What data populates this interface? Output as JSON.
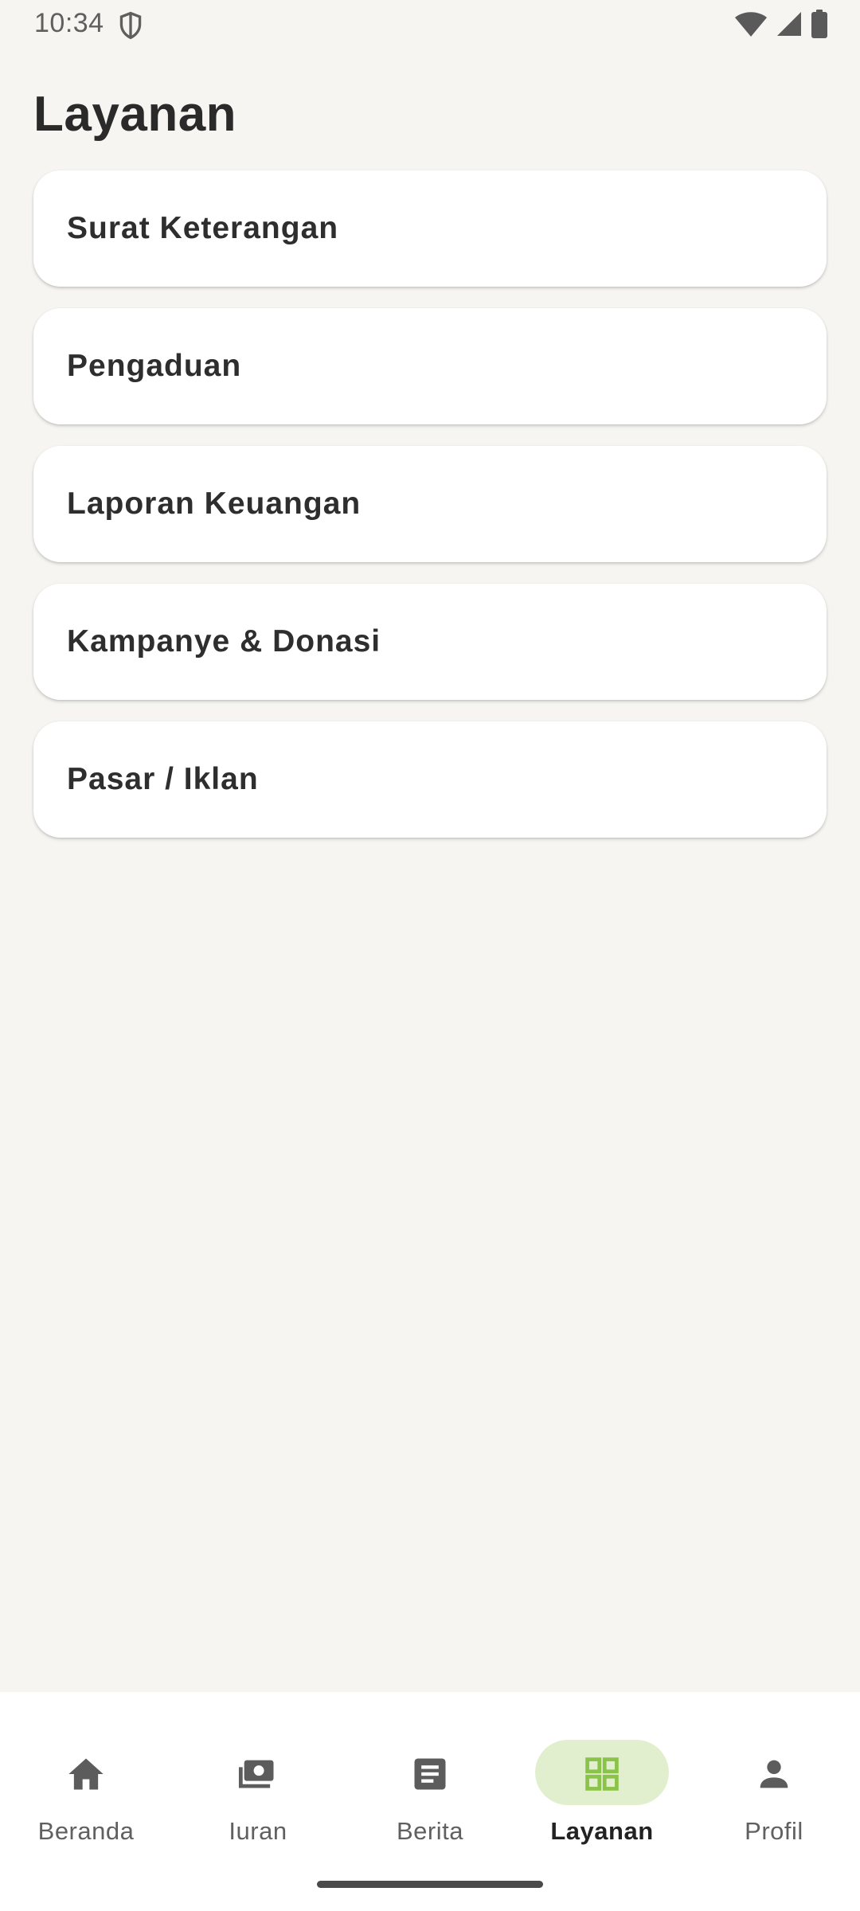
{
  "status_bar": {
    "time": "10:34"
  },
  "page": {
    "title": "Layanan"
  },
  "services": [
    {
      "label": "Surat Keterangan"
    },
    {
      "label": "Pengaduan"
    },
    {
      "label": "Laporan Keuangan"
    },
    {
      "label": "Kampanye & Donasi"
    },
    {
      "label": "Pasar / Iklan"
    }
  ],
  "bottom_nav": {
    "active": "Layanan",
    "accent_color": "#8bc34a",
    "items": [
      {
        "label": "Beranda",
        "icon": "home-icon"
      },
      {
        "label": "Iuran",
        "icon": "payments-icon"
      },
      {
        "label": "Berita",
        "icon": "article-icon"
      },
      {
        "label": "Layanan",
        "icon": "grid-icon"
      },
      {
        "label": "Profil",
        "icon": "person-icon"
      }
    ]
  }
}
